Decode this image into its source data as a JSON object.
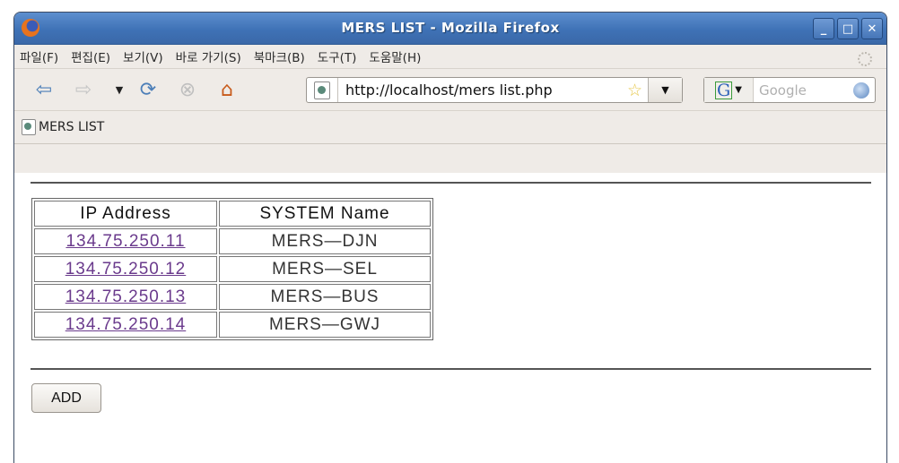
{
  "window": {
    "title": "MERS LIST - Mozilla Firefox",
    "controls": [
      "minimize",
      "maximize",
      "close"
    ]
  },
  "menubar": {
    "items": [
      "파일(F)",
      "편집(E)",
      "보기(V)",
      "바로 가기(S)",
      "북마크(B)",
      "도구(T)",
      "도움말(H)"
    ]
  },
  "navbar": {
    "url": "http://localhost/mers list.php",
    "search_placeholder": "Google",
    "search_engine": "G"
  },
  "tab": {
    "title": "MERS LIST"
  },
  "page": {
    "table": {
      "headers": [
        "IP Address",
        "SYSTEM Name"
      ],
      "rows": [
        {
          "ip": "134.75.250.11",
          "name": "MERS—DJN"
        },
        {
          "ip": "134.75.250.12",
          "name": "MERS—SEL"
        },
        {
          "ip": "134.75.250.13",
          "name": "MERS—BUS"
        },
        {
          "ip": "134.75.250.14",
          "name": "MERS—GWJ"
        }
      ]
    },
    "add_button": "ADD"
  }
}
